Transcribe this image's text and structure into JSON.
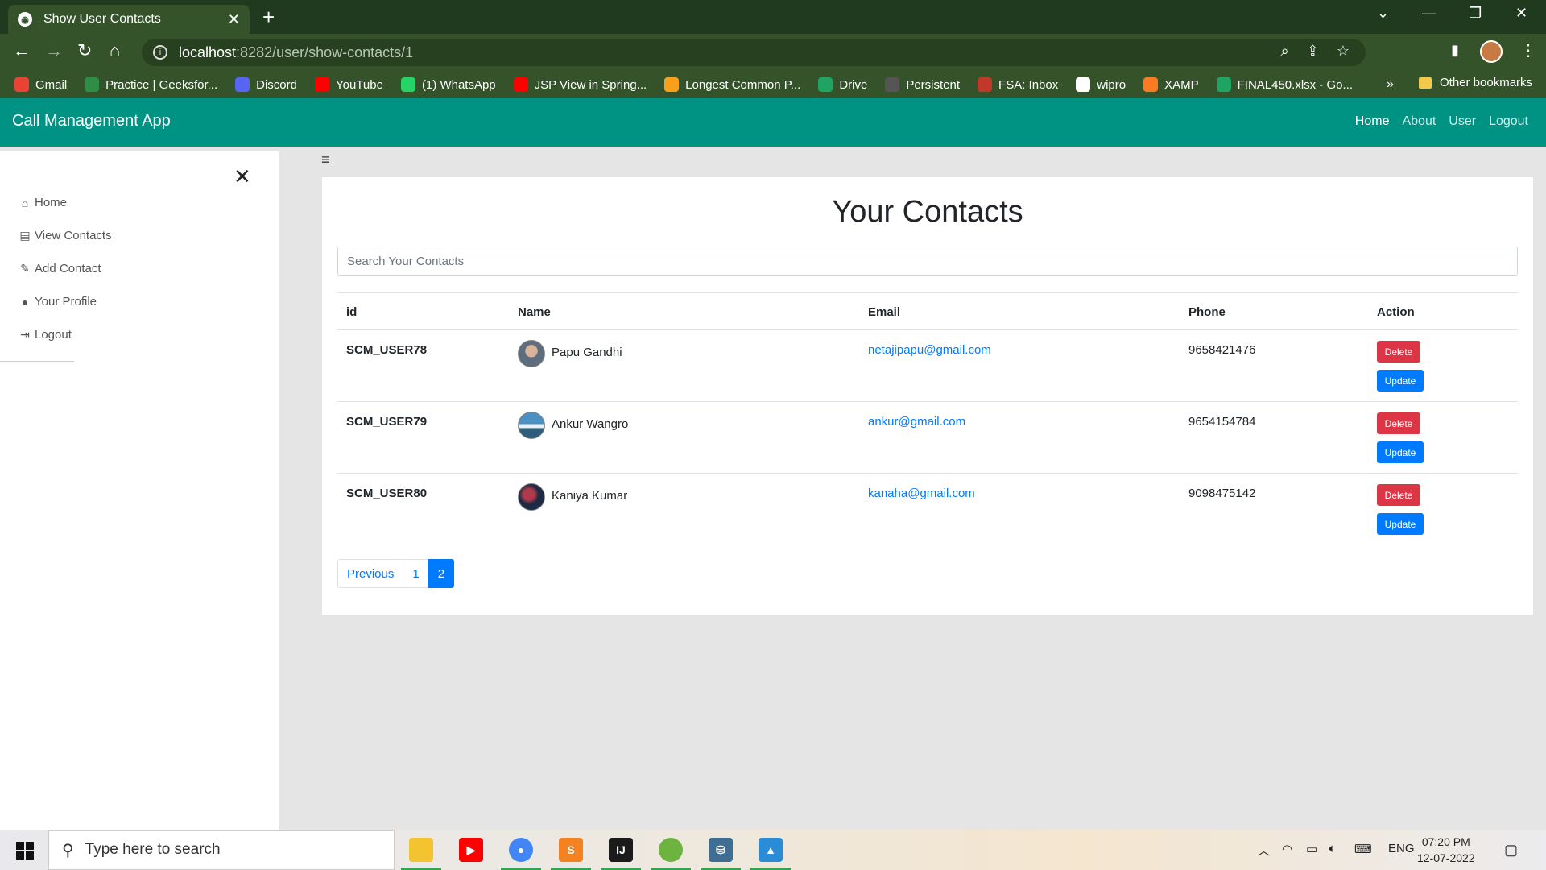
{
  "browser": {
    "tab_title": "Show User Contacts",
    "url_host": "localhost",
    "url_path": ":8282/user/show-contacts/1",
    "bookmarks": [
      {
        "label": "Gmail",
        "icon": "gmail-icon",
        "color": "#ea4335"
      },
      {
        "label": "Practice | Geeksfor...",
        "icon": "geeksforgeeks-icon",
        "color": "#2f8d46"
      },
      {
        "label": "Discord",
        "icon": "discord-icon",
        "color": "#5865f2"
      },
      {
        "label": "YouTube",
        "icon": "youtube-icon",
        "color": "#ff0000"
      },
      {
        "label": "(1) WhatsApp",
        "icon": "whatsapp-icon",
        "color": "#25d366"
      },
      {
        "label": "JSP View in Spring...",
        "icon": "youtube-icon",
        "color": "#ff0000"
      },
      {
        "label": "Longest Common P...",
        "icon": "leetcode-icon",
        "color": "#f89f1b"
      },
      {
        "label": "Drive",
        "icon": "drive-icon",
        "color": "#1fa463"
      },
      {
        "label": "Persistent",
        "icon": "persistent-icon",
        "color": "#555555"
      },
      {
        "label": "FSA: Inbox",
        "icon": "inbox-icon",
        "color": "#c0392b"
      },
      {
        "label": "wipro",
        "icon": "wipro-icon",
        "color": "#ffffff"
      },
      {
        "label": "XAMP",
        "icon": "xampp-icon",
        "color": "#fb7a24"
      },
      {
        "label": "FINAL450.xlsx - Go...",
        "icon": "drive-icon",
        "color": "#1fa463"
      }
    ],
    "more_bookmarks": "»",
    "other_bookmarks": "Other bookmarks"
  },
  "app": {
    "brand": "Call Management App",
    "nav": [
      "Home",
      "About",
      "User",
      "Logout"
    ],
    "accent": "#009384"
  },
  "sidebar": {
    "items": [
      {
        "label": "Home",
        "icon": "home-icon"
      },
      {
        "label": "View Contacts",
        "icon": "contacts-icon"
      },
      {
        "label": "Add Contact",
        "icon": "pencil-icon"
      },
      {
        "label": "Your Profile",
        "icon": "user-circle-icon"
      },
      {
        "label": "Logout",
        "icon": "logout-icon"
      }
    ]
  },
  "main": {
    "title": "Your Contacts",
    "search_placeholder": "Search Your Contacts",
    "columns": [
      "id",
      "Name",
      "Email",
      "Phone",
      "Action"
    ],
    "rows": [
      {
        "id": "SCM_USER78",
        "name": "Papu Gandhi",
        "email": "netajipapu@gmail.com",
        "phone": "9658421476"
      },
      {
        "id": "SCM_USER79",
        "name": "Ankur Wangro",
        "email": "ankur@gmail.com",
        "phone": "9654154784"
      },
      {
        "id": "SCM_USER80",
        "name": "Kaniya Kumar",
        "email": "kanaha@gmail.com",
        "phone": "9098475142"
      }
    ],
    "delete_label": "Delete",
    "update_label": "Update",
    "pagination": {
      "previous": "Previous",
      "pages": [
        "1",
        "2"
      ],
      "active": "2"
    }
  },
  "taskbar": {
    "search_placeholder": "Type here to search",
    "language": "ENG",
    "time": "07:20 PM",
    "date": "12-07-2022"
  }
}
